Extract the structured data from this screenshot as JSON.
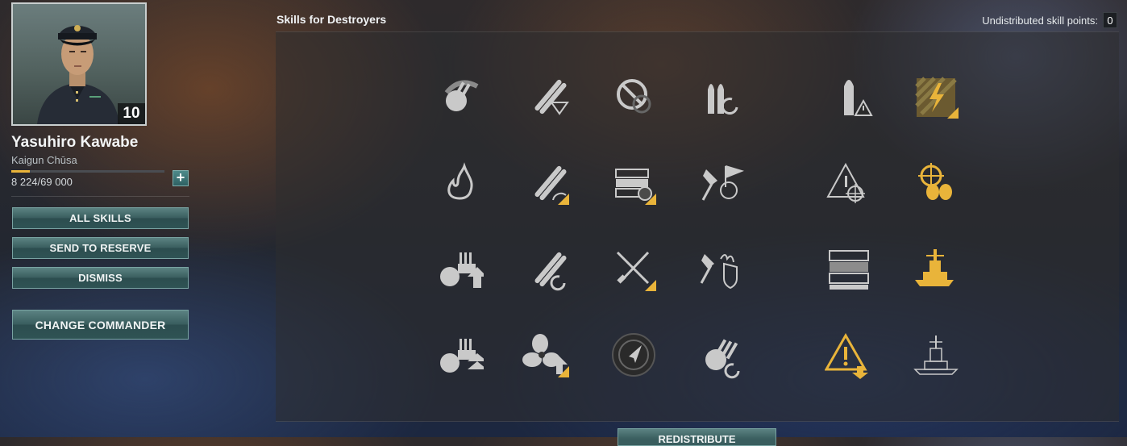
{
  "commander": {
    "name": "Yasuhiro Kawabe",
    "rank": "Kaigun Chūsa",
    "level": "10",
    "xp_text": "8 224/69 000",
    "xp_progress": 0.119,
    "add_button": "+"
  },
  "actions": {
    "all_skills": "ALL SKILLS",
    "send_to_reserve": "SEND TO RESERVE",
    "dismiss": "DISMISS",
    "change_commander": "CHANGE COMMANDER"
  },
  "skills_panel": {
    "title": "Skills for Destroyers",
    "points_label": "Undistributed skill points:",
    "points_value": "0",
    "redistribute": "REDISTRIBUTE"
  },
  "skills": [
    {
      "icon": "aa-gun-rotation-icon",
      "highlight": false
    },
    {
      "icon": "torpedo-tubes-down-icon",
      "highlight": false
    },
    {
      "icon": "disabled-circle-icon",
      "highlight": false
    },
    {
      "icon": "shells-reload-icon",
      "highlight": false
    },
    {
      "icon": "shell-warning-icon",
      "highlight": false
    },
    {
      "icon": "hazard-lightning-icon",
      "highlight": true
    },
    {
      "icon": "fire-icon",
      "highlight": false
    },
    {
      "icon": "torpedo-tubes-speed-icon",
      "highlight": true
    },
    {
      "icon": "consumables-timer-icon",
      "highlight": true
    },
    {
      "icon": "explosive-flag-icon",
      "highlight": false
    },
    {
      "icon": "warning-crosshair-icon",
      "highlight": false
    },
    {
      "icon": "wheel-propellers-icon",
      "highlight": true
    },
    {
      "icon": "aa-gun-upgrade-icon",
      "highlight": false
    },
    {
      "icon": "torpedo-tubes-reload-icon",
      "highlight": false
    },
    {
      "icon": "crossed-tools-icon",
      "highlight": true
    },
    {
      "icon": "fire-shield-icon",
      "highlight": false
    },
    {
      "icon": "consumables-stack-icon",
      "highlight": false
    },
    {
      "icon": "battleship-gold-icon",
      "highlight": true
    },
    {
      "icon": "aa-gun-double-upgrade-icon",
      "highlight": false
    },
    {
      "icon": "propeller-upgrade-icon",
      "highlight": true
    },
    {
      "icon": "radar-compass-icon",
      "highlight": false
    },
    {
      "icon": "aa-gun-reload-icon",
      "highlight": false
    },
    {
      "icon": "warning-arrow-icon",
      "highlight": true
    },
    {
      "icon": "ship-silhouette-icon",
      "highlight": false
    }
  ],
  "colors": {
    "accent": "#e9b43a",
    "icon_gray": "#c9c9c9",
    "button_teal": "#3a5e5f"
  }
}
